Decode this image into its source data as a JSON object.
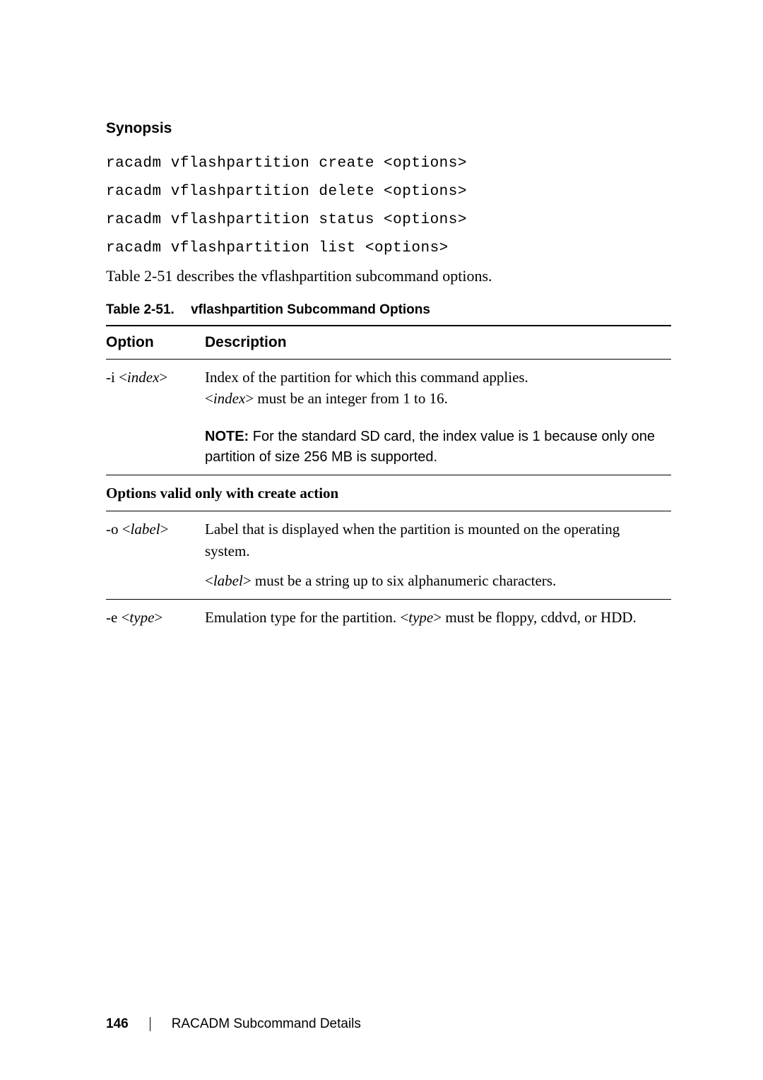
{
  "synopsis": {
    "heading": "Synopsis",
    "code": [
      "racadm vflashpartition create <options>",
      "racadm vflashpartition delete <options>",
      "racadm vflashpartition status <options>",
      "racadm vflashpartition list <options>"
    ],
    "body": "Table 2-51 describes the vflashpartition subcommand options."
  },
  "table": {
    "title_num": "Table 2-51.",
    "title_text": "vflashpartition Subcommand Options",
    "header": {
      "option": "Option",
      "description": "Description"
    },
    "rows": {
      "i": {
        "opt_prefix": "-i <",
        "opt_var": "index",
        "opt_suffix": ">",
        "desc_line1_a": "Index of the partition for which this command applies.",
        "desc_line2_a": "<",
        "desc_line2_var": "index",
        "desc_line2_b": "> must be an integer from 1 to 16."
      },
      "note": {
        "label": "NOTE: ",
        "text": "For the standard SD card, the index value is 1 because only one partition of size 256 MB is supported."
      },
      "section_create": "Options valid only with create action",
      "o": {
        "opt_prefix": "-o <",
        "opt_var": "label",
        "opt_suffix": ">",
        "desc_line1": "Label that is displayed when the partition is mounted on the operating system.",
        "desc_line2_a": "<",
        "desc_line2_var": "label",
        "desc_line2_b": "> must be a string up to six alphanumeric characters."
      },
      "e": {
        "opt_prefix": "-e <",
        "opt_var": "type",
        "opt_suffix": ">",
        "desc_a": "Emulation type for the partition. <",
        "desc_var": "type",
        "desc_b": "> must be floppy, cddvd, or HDD."
      }
    }
  },
  "footer": {
    "page": "146",
    "section": "RACADM Subcommand Details"
  }
}
